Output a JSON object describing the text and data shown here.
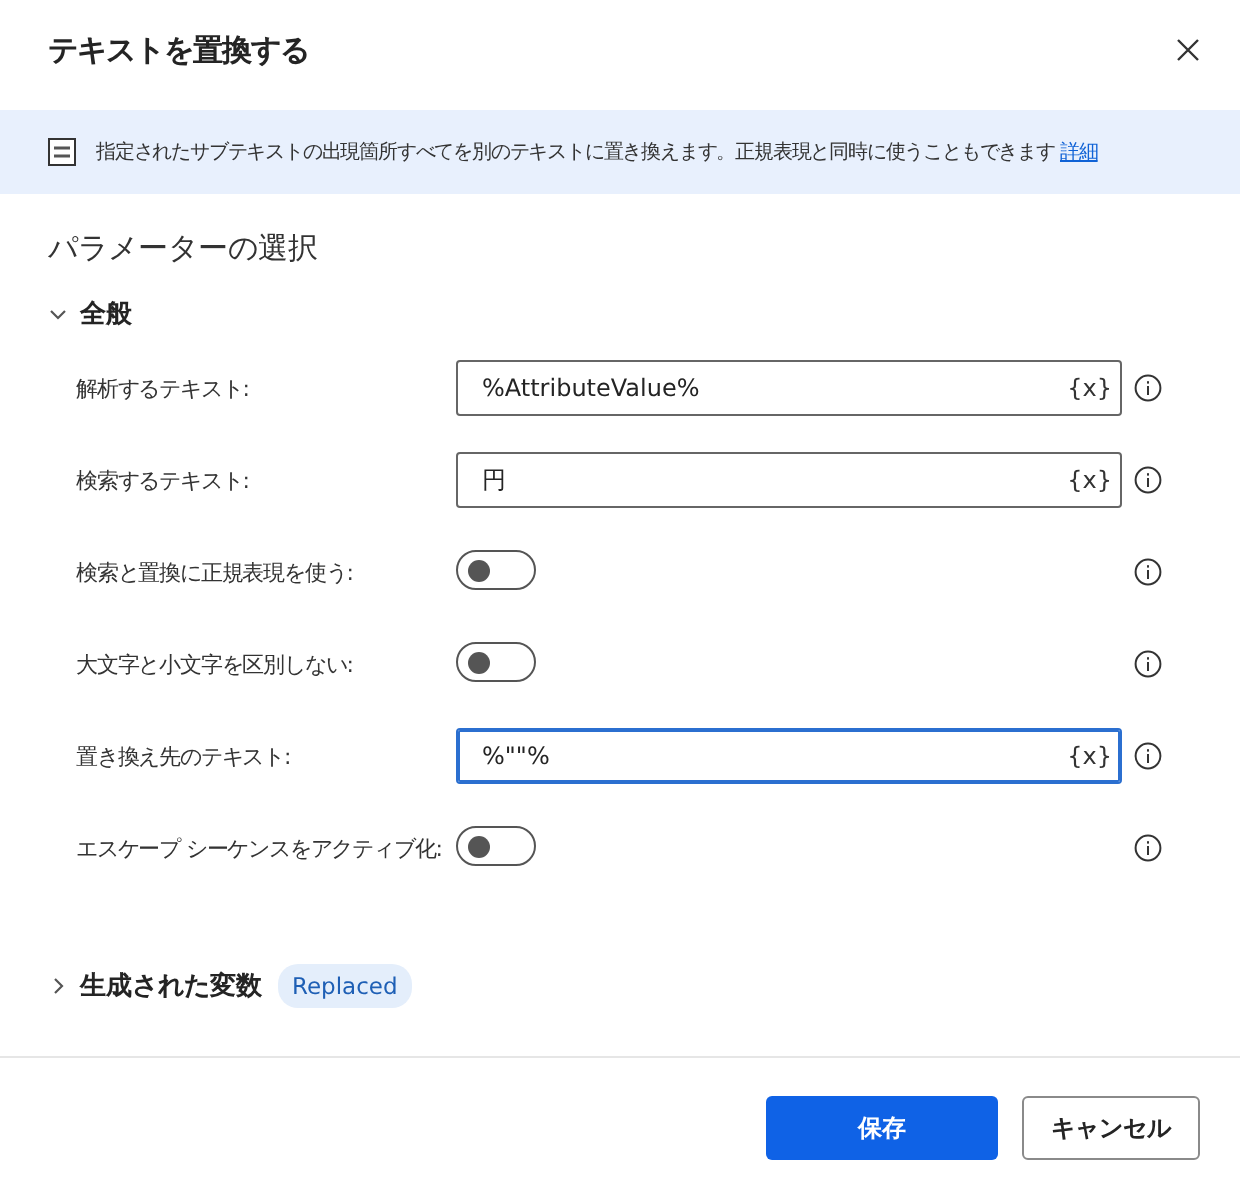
{
  "window": {
    "title": "テキストを置換する"
  },
  "banner": {
    "text": "指定されたサブテキストの出現箇所すべてを別のテキストに置き換えます。正規表現と同時に使うこともできます",
    "link": "詳細"
  },
  "parameters": {
    "heading": "パラメーターの選択",
    "section": {
      "label": "全般",
      "expanded": true
    },
    "rows": [
      {
        "kind": "text",
        "label": "解析するテキスト:",
        "value": "%AttributeValue%",
        "focused": false,
        "var_button": "{x}"
      },
      {
        "kind": "text",
        "label": "検索するテキスト:",
        "value": "円",
        "focused": false,
        "var_button": "{x}"
      },
      {
        "kind": "toggle",
        "label": "検索と置換に正規表現を使う:",
        "on": false
      },
      {
        "kind": "toggle",
        "label": "大文字と小文字を区別しない:",
        "on": false
      },
      {
        "kind": "text",
        "label": "置き換え先のテキスト:",
        "value": "%\"\"%",
        "focused": true,
        "var_button": "{x}"
      },
      {
        "kind": "toggle",
        "label": "エスケープ シーケンスをアクティブ化:",
        "on": false
      }
    ]
  },
  "variables": {
    "label": "生成された変数",
    "expanded": false,
    "tags": [
      "Replaced"
    ]
  },
  "buttons": [
    {
      "label": "保存",
      "kind": "primary"
    },
    {
      "label": "キャンセル",
      "kind": "secondary"
    }
  ]
}
